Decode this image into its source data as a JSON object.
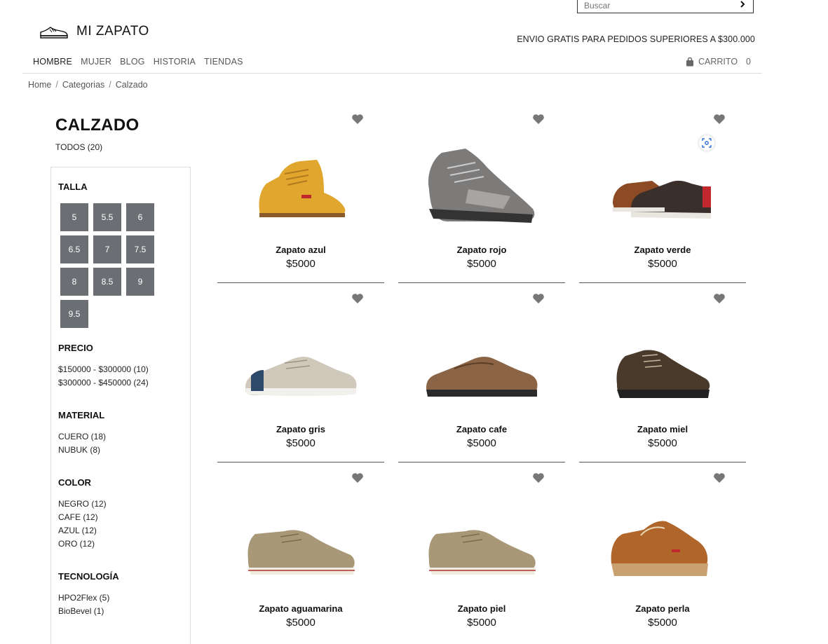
{
  "header": {
    "search_placeholder": "Buscar",
    "brand": "MI ZAPATO",
    "promo": "ENVIO GRATIS PARA PEDIDOS SUPERIORES A $300.000",
    "nav": [
      "HOMBRE",
      "MUJER",
      "BLOG",
      "HISTORIA",
      "TIENDAS"
    ],
    "cart_label": "CARRITO",
    "cart_count": "0"
  },
  "breadcrumb": [
    "Home",
    "Categorias",
    "Calzado"
  ],
  "category": {
    "title": "CALZADO",
    "all": "TODOS (20)"
  },
  "filters": {
    "talla": {
      "title": "TALLA",
      "sizes": [
        "5",
        "5.5",
        "6",
        "6.5",
        "7",
        "7.5",
        "8",
        "8.5",
        "9",
        "9.5"
      ]
    },
    "precio": {
      "title": "PRECIO",
      "items": [
        "$150000 - $300000 (10)",
        "$300000 - $450000 (24)"
      ]
    },
    "material": {
      "title": "MATERIAL",
      "items": [
        "CUERO (18)",
        "NUBUK (8)"
      ]
    },
    "color": {
      "title": "COLOR",
      "items": [
        "NEGRO (12)",
        "CAFE (12)",
        "AZUL (12)",
        "ORO (12)"
      ]
    },
    "tecnologia": {
      "title": "TECNOLOGÍA",
      "items": [
        "HPO2Flex (5)",
        "BioBevel (1)"
      ]
    }
  },
  "products": [
    {
      "name": "Zapato azul",
      "price": "$5000"
    },
    {
      "name": "Zapato rojo",
      "price": "$5000"
    },
    {
      "name": "Zapato verde",
      "price": "$5000"
    },
    {
      "name": "Zapato gris",
      "price": "$5000"
    },
    {
      "name": "Zapato cafe",
      "price": "$5000"
    },
    {
      "name": "Zapato miel",
      "price": "$5000"
    },
    {
      "name": "Zapato aguamarina",
      "price": "$5000"
    },
    {
      "name": "Zapato piel",
      "price": "$5000"
    },
    {
      "name": "Zapato perla",
      "price": "$5000"
    }
  ],
  "colors": {
    "size_chip": "#6b6f74",
    "heart": "#777777"
  }
}
